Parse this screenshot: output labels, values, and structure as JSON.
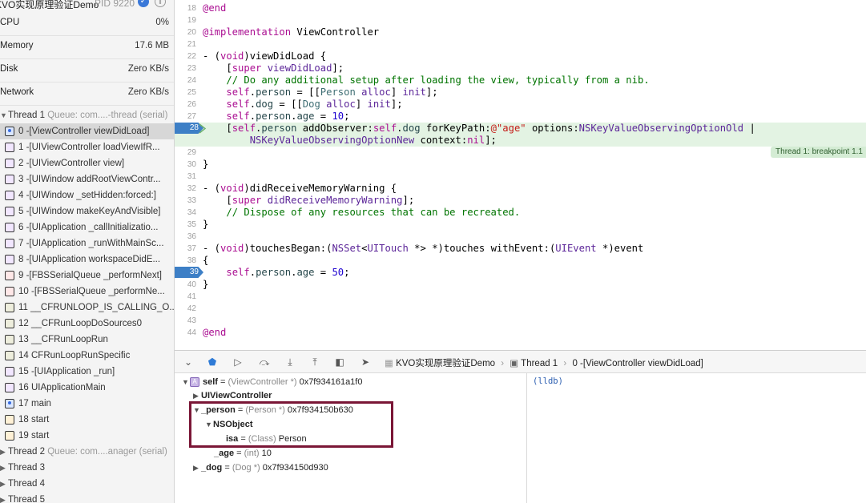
{
  "process": {
    "name": "KVO实现原理验证Demo",
    "pid": "PID 9220"
  },
  "gauges": [
    {
      "label": "CPU",
      "value": "0%"
    },
    {
      "label": "Memory",
      "value": "17.6 MB"
    },
    {
      "label": "Disk",
      "value": "Zero KB/s"
    },
    {
      "label": "Network",
      "value": "Zero KB/s"
    }
  ],
  "thread1": {
    "title": "Thread 1",
    "queue": "Queue: com....-thread (serial)"
  },
  "frames": [
    {
      "label": "0 -[ViewController viewDidLoad]",
      "kind": "user"
    },
    {
      "label": "1 -[UIViewController loadViewIfR...",
      "kind": "fw"
    },
    {
      "label": "2 -[UIViewController view]",
      "kind": "fw"
    },
    {
      "label": "3 -[UIWindow addRootViewContr...",
      "kind": "fw"
    },
    {
      "label": "4 -[UIWindow _setHidden:forced:]",
      "kind": "fw"
    },
    {
      "label": "5 -[UIWindow makeKeyAndVisible]",
      "kind": "fw"
    },
    {
      "label": "6 -[UIApplication _callInitializatio...",
      "kind": "fw"
    },
    {
      "label": "7 -[UIApplication _runWithMainSc...",
      "kind": "fw"
    },
    {
      "label": "8 -[UIApplication workspaceDidE...",
      "kind": "fw"
    },
    {
      "label": "9 -[FBSSerialQueue _performNext]",
      "kind": "lib"
    },
    {
      "label": "10 -[FBSSerialQueue _performNe...",
      "kind": "lib"
    },
    {
      "label": "11 __CFRUNLOOP_IS_CALLING_O...",
      "kind": "sys"
    },
    {
      "label": "12 __CFRunLoopDoSources0",
      "kind": "sys"
    },
    {
      "label": "13 __CFRunLoopRun",
      "kind": "sys"
    },
    {
      "label": "14 CFRunLoopRunSpecific",
      "kind": "sys"
    },
    {
      "label": "15 -[UIApplication _run]",
      "kind": "fw"
    },
    {
      "label": "16 UIApplicationMain",
      "kind": "fw"
    },
    {
      "label": "17 main",
      "kind": "user"
    },
    {
      "label": "18 start",
      "kind": "obj"
    },
    {
      "label": "19 start",
      "kind": "obj"
    }
  ],
  "other_threads": [
    {
      "title": "Thread 2",
      "queue": "Queue: com....anager (serial)"
    },
    {
      "title": "Thread 3",
      "queue": ""
    },
    {
      "title": "Thread 4",
      "queue": ""
    },
    {
      "title": "Thread 5",
      "queue": ""
    }
  ],
  "code_lines": [
    {
      "n": "18",
      "html": "<span class='k'>@end</span>"
    },
    {
      "n": "19",
      "html": ""
    },
    {
      "n": "20",
      "html": "<span class='k'>@implementation</span> ViewController"
    },
    {
      "n": "21",
      "html": ""
    },
    {
      "n": "22",
      "html": "- (<span class='k'>void</span>)viewDidLoad {"
    },
    {
      "n": "23",
      "html": "    [<span class='k'>super</span> <span class='tp'>viewDidLoad</span>];"
    },
    {
      "n": "24",
      "html": "    <span class='c'>// Do any additional setup after loading the view, typically from a nib.</span>"
    },
    {
      "n": "25",
      "html": "    <span class='k'>self</span>.<span class='m'>person</span> = [[<span class='t'>Person</span> <span class='tp'>alloc</span>] <span class='tp'>init</span>];"
    },
    {
      "n": "26",
      "html": "    <span class='k'>self</span>.<span class='m'>dog</span> = [[<span class='t'>Dog</span> <span class='tp'>alloc</span>] <span class='tp'>init</span>];"
    },
    {
      "n": "27",
      "html": "    <span class='k'>self</span>.<span class='m'>person</span>.<span class='m'>age</span> = <span class='n'>10</span>;"
    },
    {
      "n": "28",
      "html": "    [<span class='k'>self</span>.<span class='m'>person</span> addObserver:<span class='k'>self</span>.<span class='m'>dog</span> forKeyPath:<span class='s'>@\"age\"</span> options:<span class='tp'>NSKeyValueObservingOptionOld</span> |\n        <span class='tp'>NSKeyValueObservingOptionNew</span> context:<span class='k'>nil</span>];"
    },
    {
      "n": "29",
      "html": ""
    },
    {
      "n": "30",
      "html": "}"
    },
    {
      "n": "31",
      "html": ""
    },
    {
      "n": "32",
      "html": "- (<span class='k'>void</span>)didReceiveMemoryWarning {"
    },
    {
      "n": "33",
      "html": "    [<span class='k'>super</span> <span class='tp'>didReceiveMemoryWarning</span>];"
    },
    {
      "n": "34",
      "html": "    <span class='c'>// Dispose of any resources that can be recreated.</span>"
    },
    {
      "n": "35",
      "html": "}"
    },
    {
      "n": "36",
      "html": ""
    },
    {
      "n": "37",
      "html": "- (<span class='k'>void</span>)touchesBegan:(<span class='tp'>NSSet</span>&lt;<span class='tp'>UITouch</span> *&gt; *)touches withEvent:(<span class='tp'>UIEvent</span> *)event"
    },
    {
      "n": "38",
      "html": "{"
    },
    {
      "n": "39",
      "html": "    <span class='k'>self</span>.<span class='m'>person</span>.<span class='m'>age</span> = <span class='n'>50</span>;"
    },
    {
      "n": "40",
      "html": "}"
    },
    {
      "n": "41",
      "html": ""
    },
    {
      "n": "42",
      "html": ""
    },
    {
      "n": "43",
      "html": ""
    },
    {
      "n": "44",
      "html": "<span class='k'>@end</span>"
    }
  ],
  "breakpoint_badge": "Thread 1: breakpoint 1.1",
  "breadcrumb": {
    "project": "KVO实现原理验证Demo",
    "thread": "Thread 1",
    "frame": "0 -[ViewController viewDidLoad]"
  },
  "variables": {
    "self": {
      "name": "self",
      "eq": " = ",
      "type": "(ViewController *)",
      "value": " 0x7f934161a1f0"
    },
    "super": {
      "name": "UIViewController"
    },
    "person": {
      "name": "_person",
      "eq": " = ",
      "type": "(Person *)",
      "value": " 0x7f934150b630"
    },
    "nsobject": {
      "name": "NSObject"
    },
    "isa": {
      "name": "isa",
      "eq": " = ",
      "type": "(Class)",
      "value": " Person"
    },
    "age": {
      "name": "_age",
      "eq": " = ",
      "type": "(int)",
      "value": " 10"
    },
    "dog": {
      "name": "_dog",
      "eq": " = ",
      "type": "(Dog *)",
      "value": " 0x7f934150d930"
    }
  },
  "console": {
    "prompt": "(lldb)"
  }
}
